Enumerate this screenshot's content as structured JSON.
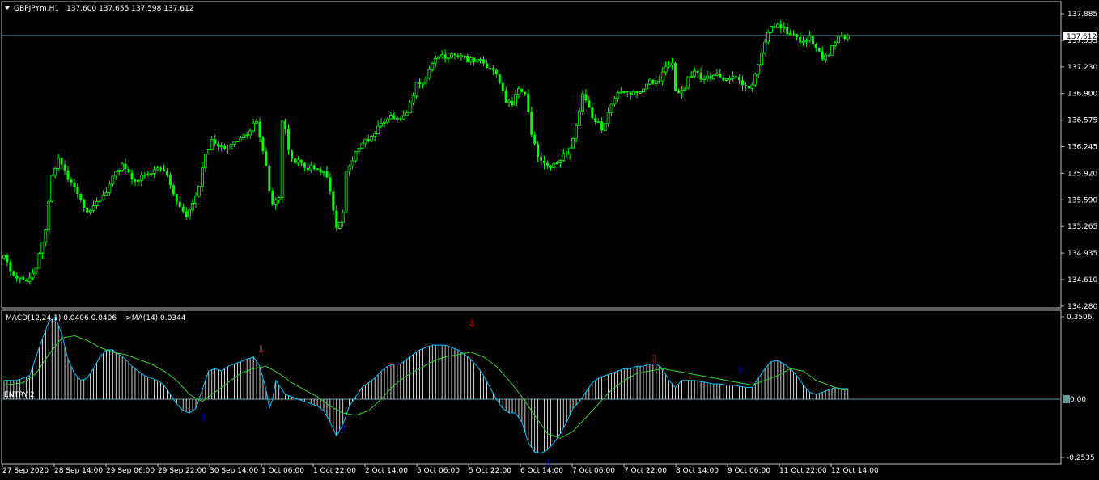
{
  "header": {
    "symbol": "GBPJPYm,H1",
    "ohlc": "137.600 137.655 137.598 137.612",
    "menu_icon": "triangle-down-icon"
  },
  "macd_header": {
    "label": "MACD(12,24,1) 0.0406 0.0406",
    "ma_label": "->MA(14) 0.0344"
  },
  "entry_label": "ENTRY 2",
  "current_price_label": "137.612",
  "macd_zero_label": "0.00",
  "colors": {
    "background": "#000000",
    "candle": "#00ff00",
    "price_line": "#5f9ea0",
    "histogram": "#ffffff",
    "macd_line": "#00bfff",
    "signal_line": "#32cd32",
    "up_arrow": "#0000cd",
    "down_arrow": "#ff0000",
    "axis": "#c0c0c0"
  },
  "chart_data": [
    {
      "type": "candlestick",
      "title": "GBPJPYm,H1",
      "ylim": [
        134.2,
        137.9
      ],
      "yticks": [
        "137.885",
        "137.555",
        "137.230",
        "136.900",
        "136.575",
        "136.245",
        "135.920",
        "135.590",
        "135.265",
        "134.935",
        "134.610",
        "134.280"
      ],
      "xticks": [
        "27 Sep 2020",
        "28 Sep 14:00",
        "29 Sep 06:00",
        "29 Sep 22:00",
        "30 Sep 14:00",
        "1 Oct 06:00",
        "1 Oct 22:00",
        "2 Oct 14:00",
        "5 Oct 06:00",
        "5 Oct 22:00",
        "6 Oct 14:00",
        "7 Oct 06:00",
        "7 Oct 22:00",
        "8 Oct 14:00",
        "9 Oct 06:00",
        "11 Oct 22:00",
        "12 Oct 14:00"
      ],
      "current_price": 137.612,
      "close_path": [
        [
          0,
          134.83
        ],
        [
          3,
          134.6
        ],
        [
          7,
          134.55
        ],
        [
          10,
          134.7
        ],
        [
          13,
          135.2
        ],
        [
          15,
          135.85
        ],
        [
          17,
          136.1
        ],
        [
          19,
          135.9
        ],
        [
          21,
          135.75
        ],
        [
          23,
          135.6
        ],
        [
          25,
          135.45
        ],
        [
          27,
          135.4
        ],
        [
          29,
          135.55
        ],
        [
          31,
          135.6
        ],
        [
          33,
          135.75
        ],
        [
          35,
          135.9
        ],
        [
          37,
          136.0
        ],
        [
          39,
          135.9
        ],
        [
          41,
          135.8
        ],
        [
          43,
          135.85
        ],
        [
          45,
          135.9
        ],
        [
          47,
          135.92
        ],
        [
          49,
          135.95
        ],
        [
          51,
          135.85
        ],
        [
          53,
          135.65
        ],
        [
          55,
          135.45
        ],
        [
          57,
          135.35
        ],
        [
          59,
          135.5
        ],
        [
          61,
          135.75
        ],
        [
          63,
          136.1
        ],
        [
          65,
          136.3
        ],
        [
          67,
          136.25
        ],
        [
          69,
          136.2
        ],
        [
          71,
          136.25
        ],
        [
          73,
          136.3
        ],
        [
          75,
          136.35
        ],
        [
          77,
          136.45
        ],
        [
          79,
          136.55
        ],
        [
          81,
          136.2
        ],
        [
          83,
          135.7
        ],
        [
          84,
          135.5
        ],
        [
          86,
          135.6
        ],
        [
          87,
          136.55
        ],
        [
          88,
          136.45
        ],
        [
          89,
          136.15
        ],
        [
          91,
          136.05
        ],
        [
          93,
          136.0
        ],
        [
          95,
          135.95
        ],
        [
          97,
          135.95
        ],
        [
          99,
          135.9
        ],
        [
          101,
          135.85
        ],
        [
          103,
          135.4
        ],
        [
          104,
          135.2
        ],
        [
          106,
          135.4
        ],
        [
          107,
          135.9
        ],
        [
          109,
          136.05
        ],
        [
          111,
          136.2
        ],
        [
          113,
          136.3
        ],
        [
          115,
          136.35
        ],
        [
          117,
          136.45
        ],
        [
          119,
          136.55
        ],
        [
          121,
          136.65
        ],
        [
          123,
          136.55
        ],
        [
          125,
          136.6
        ],
        [
          127,
          136.75
        ],
        [
          129,
          137.0
        ],
        [
          131,
          137.05
        ],
        [
          133,
          137.2
        ],
        [
          135,
          137.3
        ],
        [
          137,
          137.35
        ],
        [
          139,
          137.38
        ],
        [
          141,
          137.4
        ],
        [
          143,
          137.35
        ],
        [
          145,
          137.32
        ],
        [
          147,
          137.3
        ],
        [
          149,
          137.3
        ],
        [
          151,
          137.25
        ],
        [
          153,
          137.2
        ],
        [
          155,
          137.05
        ],
        [
          157,
          136.8
        ],
        [
          159,
          136.75
        ],
        [
          161,
          136.95
        ],
        [
          163,
          136.9
        ],
        [
          165,
          136.4
        ],
        [
          167,
          136.1
        ],
        [
          169,
          136.0
        ],
        [
          171,
          135.95
        ],
        [
          173,
          136.0
        ],
        [
          175,
          136.1
        ],
        [
          177,
          136.2
        ],
        [
          179,
          136.5
        ],
        [
          181,
          136.85
        ],
        [
          183,
          136.7
        ],
        [
          185,
          136.55
        ],
        [
          187,
          136.45
        ],
        [
          189,
          136.65
        ],
        [
          191,
          136.85
        ],
        [
          193,
          136.95
        ],
        [
          195,
          136.92
        ],
        [
          197,
          136.9
        ],
        [
          199,
          136.95
        ],
        [
          201,
          137.0
        ],
        [
          203,
          137.05
        ],
        [
          205,
          137.05
        ],
        [
          207,
          137.2
        ],
        [
          209,
          137.25
        ],
        [
          210,
          136.95
        ],
        [
          212,
          136.9
        ],
        [
          214,
          137.1
        ],
        [
          216,
          137.15
        ],
        [
          218,
          137.1
        ],
        [
          220,
          137.08
        ],
        [
          222,
          137.12
        ],
        [
          224,
          137.1
        ],
        [
          226,
          137.08
        ],
        [
          228,
          137.15
        ],
        [
          230,
          137.1
        ],
        [
          232,
          136.95
        ],
        [
          234,
          137.0
        ],
        [
          236,
          137.25
        ],
        [
          238,
          137.55
        ],
        [
          240,
          137.72
        ],
        [
          242,
          137.75
        ],
        [
          244,
          137.7
        ],
        [
          246,
          137.65
        ],
        [
          248,
          137.58
        ],
        [
          250,
          137.55
        ],
        [
          252,
          137.6
        ],
        [
          254,
          137.48
        ],
        [
          256,
          137.35
        ],
        [
          258,
          137.4
        ],
        [
          260,
          137.55
        ],
        [
          262,
          137.62
        ],
        [
          264,
          137.61
        ]
      ]
    },
    {
      "type": "macd",
      "title": "MACD(12,24,1) 0.0406 0.0406 ->MA(14) 0.0344",
      "ylim": [
        -0.2535,
        0.3506
      ],
      "yticks": [
        "0.3506",
        "0.00",
        "-0.2535"
      ],
      "macd_path": [
        [
          0,
          0.08
        ],
        [
          4,
          0.08
        ],
        [
          8,
          0.1
        ],
        [
          11,
          0.22
        ],
        [
          14,
          0.33
        ],
        [
          16,
          0.35
        ],
        [
          18,
          0.28
        ],
        [
          20,
          0.17
        ],
        [
          22,
          0.11
        ],
        [
          24,
          0.08
        ],
        [
          26,
          0.09
        ],
        [
          28,
          0.13
        ],
        [
          30,
          0.18
        ],
        [
          32,
          0.21
        ],
        [
          34,
          0.21
        ],
        [
          36,
          0.19
        ],
        [
          38,
          0.17
        ],
        [
          40,
          0.14
        ],
        [
          42,
          0.12
        ],
        [
          44,
          0.1
        ],
        [
          46,
          0.09
        ],
        [
          48,
          0.08
        ],
        [
          50,
          0.06
        ],
        [
          52,
          0.02
        ],
        [
          54,
          -0.02
        ],
        [
          56,
          -0.05
        ],
        [
          58,
          -0.06
        ],
        [
          60,
          -0.04
        ],
        [
          62,
          0.04
        ],
        [
          64,
          0.12
        ],
        [
          66,
          0.13
        ],
        [
          68,
          0.12
        ],
        [
          70,
          0.14
        ],
        [
          72,
          0.15
        ],
        [
          74,
          0.16
        ],
        [
          76,
          0.17
        ],
        [
          78,
          0.18
        ],
        [
          80,
          0.14
        ],
        [
          82,
          0.04
        ],
        [
          83,
          -0.04
        ],
        [
          84,
          0.0
        ],
        [
          85,
          0.08
        ],
        [
          86,
          0.06
        ],
        [
          88,
          0.02
        ],
        [
          90,
          0.01
        ],
        [
          92,
          0.0
        ],
        [
          94,
          -0.01
        ],
        [
          96,
          -0.02
        ],
        [
          98,
          -0.03
        ],
        [
          100,
          -0.05
        ],
        [
          102,
          -0.1
        ],
        [
          104,
          -0.16
        ],
        [
          106,
          -0.11
        ],
        [
          108,
          -0.03
        ],
        [
          110,
          0.01
        ],
        [
          112,
          0.05
        ],
        [
          114,
          0.07
        ],
        [
          116,
          0.09
        ],
        [
          118,
          0.12
        ],
        [
          120,
          0.14
        ],
        [
          122,
          0.15
        ],
        [
          124,
          0.15
        ],
        [
          126,
          0.17
        ],
        [
          128,
          0.19
        ],
        [
          130,
          0.21
        ],
        [
          132,
          0.22
        ],
        [
          134,
          0.23
        ],
        [
          136,
          0.23
        ],
        [
          138,
          0.23
        ],
        [
          140,
          0.22
        ],
        [
          142,
          0.21
        ],
        [
          144,
          0.19
        ],
        [
          146,
          0.17
        ],
        [
          148,
          0.14
        ],
        [
          150,
          0.1
        ],
        [
          152,
          0.05
        ],
        [
          154,
          0.0
        ],
        [
          156,
          -0.04
        ],
        [
          158,
          -0.06
        ],
        [
          160,
          -0.06
        ],
        [
          162,
          -0.1
        ],
        [
          164,
          -0.19
        ],
        [
          166,
          -0.23
        ],
        [
          168,
          -0.235
        ],
        [
          170,
          -0.22
        ],
        [
          172,
          -0.19
        ],
        [
          174,
          -0.15
        ],
        [
          176,
          -0.1
        ],
        [
          178,
          -0.04
        ],
        [
          180,
          -0.01
        ],
        [
          182,
          0.03
        ],
        [
          184,
          0.07
        ],
        [
          186,
          0.09
        ],
        [
          188,
          0.1
        ],
        [
          190,
          0.11
        ],
        [
          192,
          0.12
        ],
        [
          194,
          0.13
        ],
        [
          196,
          0.13
        ],
        [
          198,
          0.14
        ],
        [
          200,
          0.14
        ],
        [
          202,
          0.15
        ],
        [
          204,
          0.15
        ],
        [
          206,
          0.13
        ],
        [
          208,
          0.08
        ],
        [
          210,
          0.05
        ],
        [
          212,
          0.08
        ],
        [
          214,
          0.08
        ],
        [
          216,
          0.08
        ],
        [
          218,
          0.075
        ],
        [
          220,
          0.07
        ],
        [
          222,
          0.065
        ],
        [
          224,
          0.065
        ],
        [
          226,
          0.06
        ],
        [
          228,
          0.06
        ],
        [
          230,
          0.055
        ],
        [
          232,
          0.05
        ],
        [
          234,
          0.05
        ],
        [
          236,
          0.09
        ],
        [
          238,
          0.13
        ],
        [
          240,
          0.16
        ],
        [
          242,
          0.165
        ],
        [
          244,
          0.15
        ],
        [
          246,
          0.13
        ],
        [
          248,
          0.1
        ],
        [
          250,
          0.06
        ],
        [
          252,
          0.03
        ],
        [
          254,
          0.02
        ],
        [
          256,
          0.03
        ],
        [
          258,
          0.04
        ],
        [
          260,
          0.05
        ],
        [
          262,
          0.045
        ]
      ],
      "signal_path": [
        [
          0,
          0.06
        ],
        [
          6,
          0.07
        ],
        [
          10,
          0.11
        ],
        [
          14,
          0.19
        ],
        [
          18,
          0.26
        ],
        [
          22,
          0.27
        ],
        [
          26,
          0.25
        ],
        [
          30,
          0.22
        ],
        [
          34,
          0.2
        ],
        [
          38,
          0.19
        ],
        [
          42,
          0.17
        ],
        [
          46,
          0.15
        ],
        [
          50,
          0.12
        ],
        [
          54,
          0.08
        ],
        [
          58,
          0.02
        ],
        [
          62,
          -0.01
        ],
        [
          66,
          0.03
        ],
        [
          70,
          0.07
        ],
        [
          74,
          0.11
        ],
        [
          78,
          0.13
        ],
        [
          82,
          0.14
        ],
        [
          86,
          0.11
        ],
        [
          90,
          0.07
        ],
        [
          94,
          0.04
        ],
        [
          98,
          0.01
        ],
        [
          102,
          -0.03
        ],
        [
          106,
          -0.06
        ],
        [
          110,
          -0.07
        ],
        [
          114,
          -0.05
        ],
        [
          118,
          0.0
        ],
        [
          122,
          0.06
        ],
        [
          126,
          0.1
        ],
        [
          130,
          0.13
        ],
        [
          134,
          0.16
        ],
        [
          138,
          0.18
        ],
        [
          142,
          0.19
        ],
        [
          146,
          0.2
        ],
        [
          150,
          0.18
        ],
        [
          154,
          0.14
        ],
        [
          158,
          0.08
        ],
        [
          162,
          0.01
        ],
        [
          166,
          -0.07
        ],
        [
          170,
          -0.15
        ],
        [
          174,
          -0.17
        ],
        [
          178,
          -0.14
        ],
        [
          182,
          -0.08
        ],
        [
          186,
          -0.02
        ],
        [
          190,
          0.04
        ],
        [
          194,
          0.08
        ],
        [
          198,
          0.11
        ],
        [
          202,
          0.12
        ],
        [
          206,
          0.13
        ],
        [
          210,
          0.12
        ],
        [
          214,
          0.11
        ],
        [
          218,
          0.1
        ],
        [
          222,
          0.09
        ],
        [
          226,
          0.08
        ],
        [
          230,
          0.07
        ],
        [
          234,
          0.06
        ],
        [
          238,
          0.08
        ],
        [
          242,
          0.1
        ],
        [
          246,
          0.13
        ],
        [
          250,
          0.12
        ],
        [
          254,
          0.08
        ],
        [
          258,
          0.06
        ],
        [
          262,
          0.04
        ]
      ],
      "down_arrows": [
        [
          80,
          0.21
        ],
        [
          146,
          0.32
        ],
        [
          203,
          0.17
        ]
      ],
      "up_arrows": [
        [
          62,
          -0.08
        ],
        [
          106,
          -0.13
        ],
        [
          170,
          -0.28
        ],
        [
          230,
          0.12
        ]
      ],
      "arrow_glyph_down": "⇩",
      "arrow_glyph_up": "⇧"
    }
  ]
}
